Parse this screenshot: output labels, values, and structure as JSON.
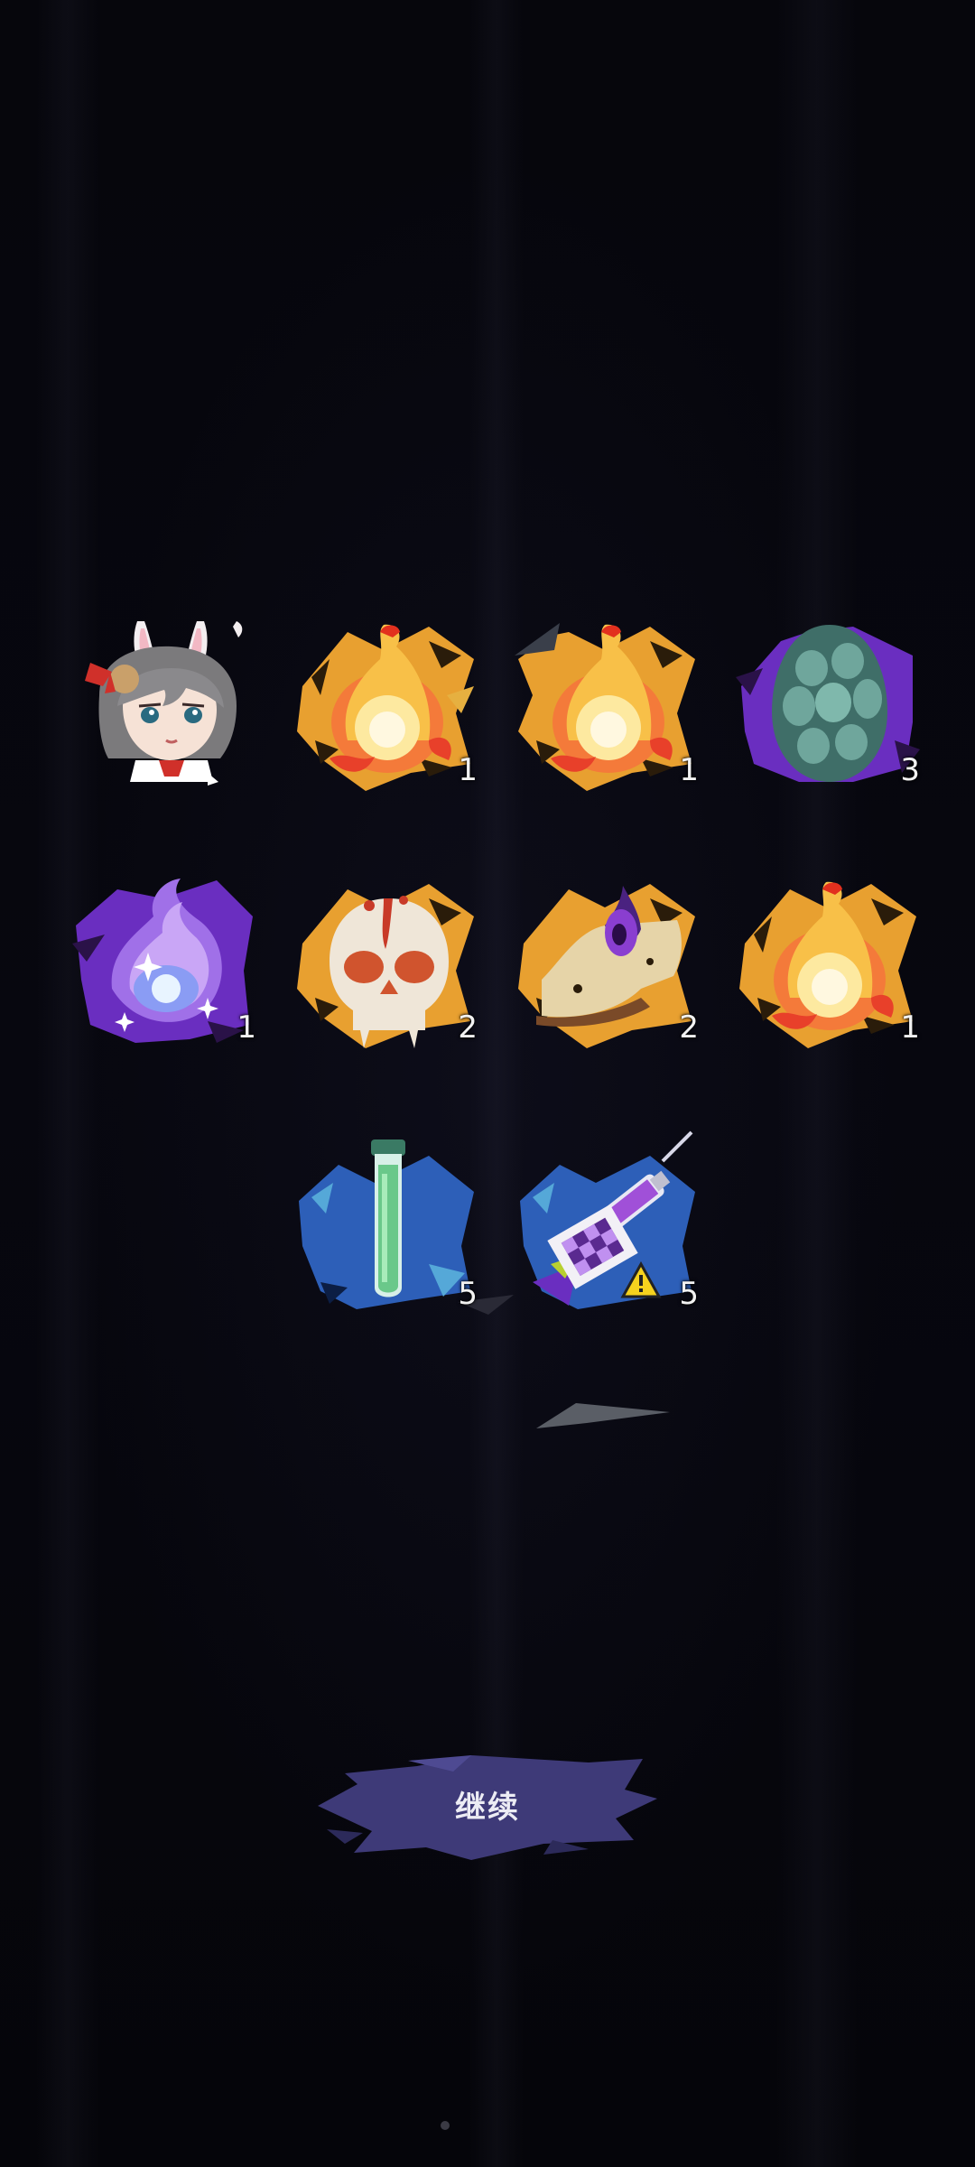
{
  "rewards": {
    "items": [
      {
        "name": "rabbit-ear-girl-portrait",
        "count": ""
      },
      {
        "name": "fire-bird-item",
        "count": "1"
      },
      {
        "name": "fire-bird-item",
        "count": "1"
      },
      {
        "name": "stone-egg-item",
        "count": "3"
      },
      {
        "name": "purple-spirit-flame-item",
        "count": "1"
      },
      {
        "name": "bloody-skull-item",
        "count": "2"
      },
      {
        "name": "cursed-scroll-item",
        "count": "2"
      },
      {
        "name": "fire-bird-item",
        "count": "1"
      },
      {
        "name": "green-test-tube-item",
        "count": "5"
      },
      {
        "name": "purple-syringe-item",
        "count": "5"
      }
    ]
  },
  "continue_button": {
    "label": "继续"
  },
  "colors": {
    "background": "#05050b",
    "fire_splash": "#f0a830",
    "purple_splash": "#6a2ec0",
    "blue_splash": "#2d5fb8",
    "button": "#3e3a78"
  }
}
